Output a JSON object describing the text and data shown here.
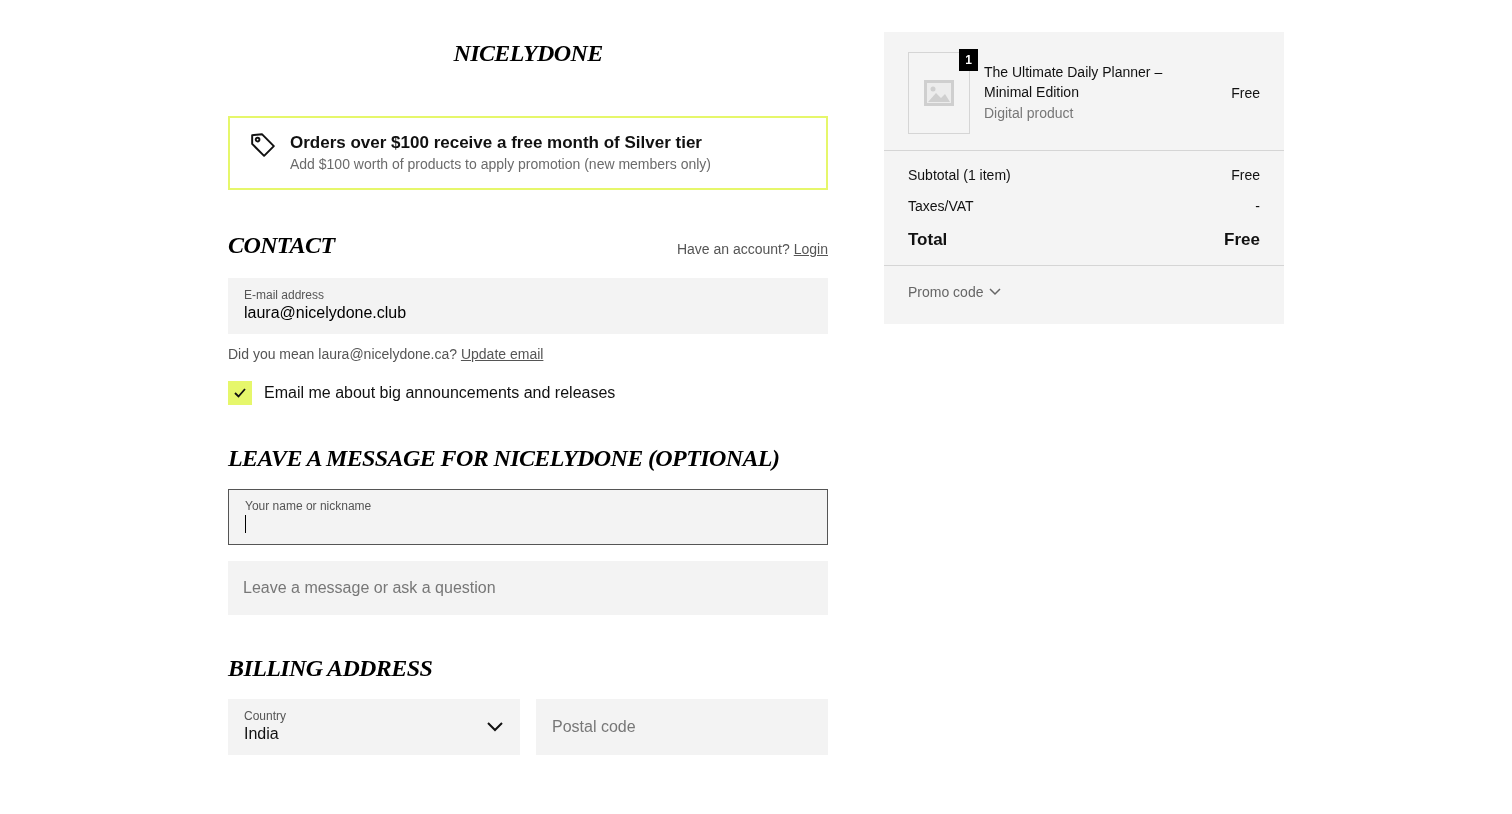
{
  "logo": "NICELYDONE",
  "promo": {
    "title": "Orders over $100 receive a free month of Silver tier",
    "subtitle": "Add $100 worth of products to apply promotion (new members only)"
  },
  "contact": {
    "heading": "CONTACT",
    "account_prompt": "Have an account?",
    "login_link": "Login",
    "email_field": {
      "label": "E-mail address",
      "value": "laura@nicelydone.club"
    },
    "suggestion": {
      "text": "Did you mean laura@nicelydone.ca?",
      "link": "Update email"
    },
    "newsletter": {
      "label": "Email me about big announcements and releases",
      "checked": true
    }
  },
  "message": {
    "heading": "LEAVE A MESSAGE FOR NICELYDONE (OPTIONAL)",
    "name_field": {
      "label": "Your name or nickname",
      "focused": true
    },
    "message_field": {
      "placeholder": "Leave a message or ask a question"
    }
  },
  "billing": {
    "heading": "BILLING ADDRESS",
    "country": {
      "label": "Country",
      "value": "India"
    },
    "postal": {
      "placeholder": "Postal code"
    }
  },
  "summary": {
    "items": [
      {
        "quantity": "1",
        "name": "The Ultimate Daily Planner – Minimal Edition",
        "type": "Digital product",
        "price": "Free"
      }
    ],
    "rows": [
      {
        "kind": "normal",
        "label": "Subtotal (1 item)",
        "value": "Free"
      },
      {
        "kind": "normal",
        "label": "Taxes/VAT",
        "value": "-"
      },
      {
        "kind": "total",
        "label": "Total",
        "value": "Free"
      }
    ],
    "promo_code": "Promo code"
  }
}
